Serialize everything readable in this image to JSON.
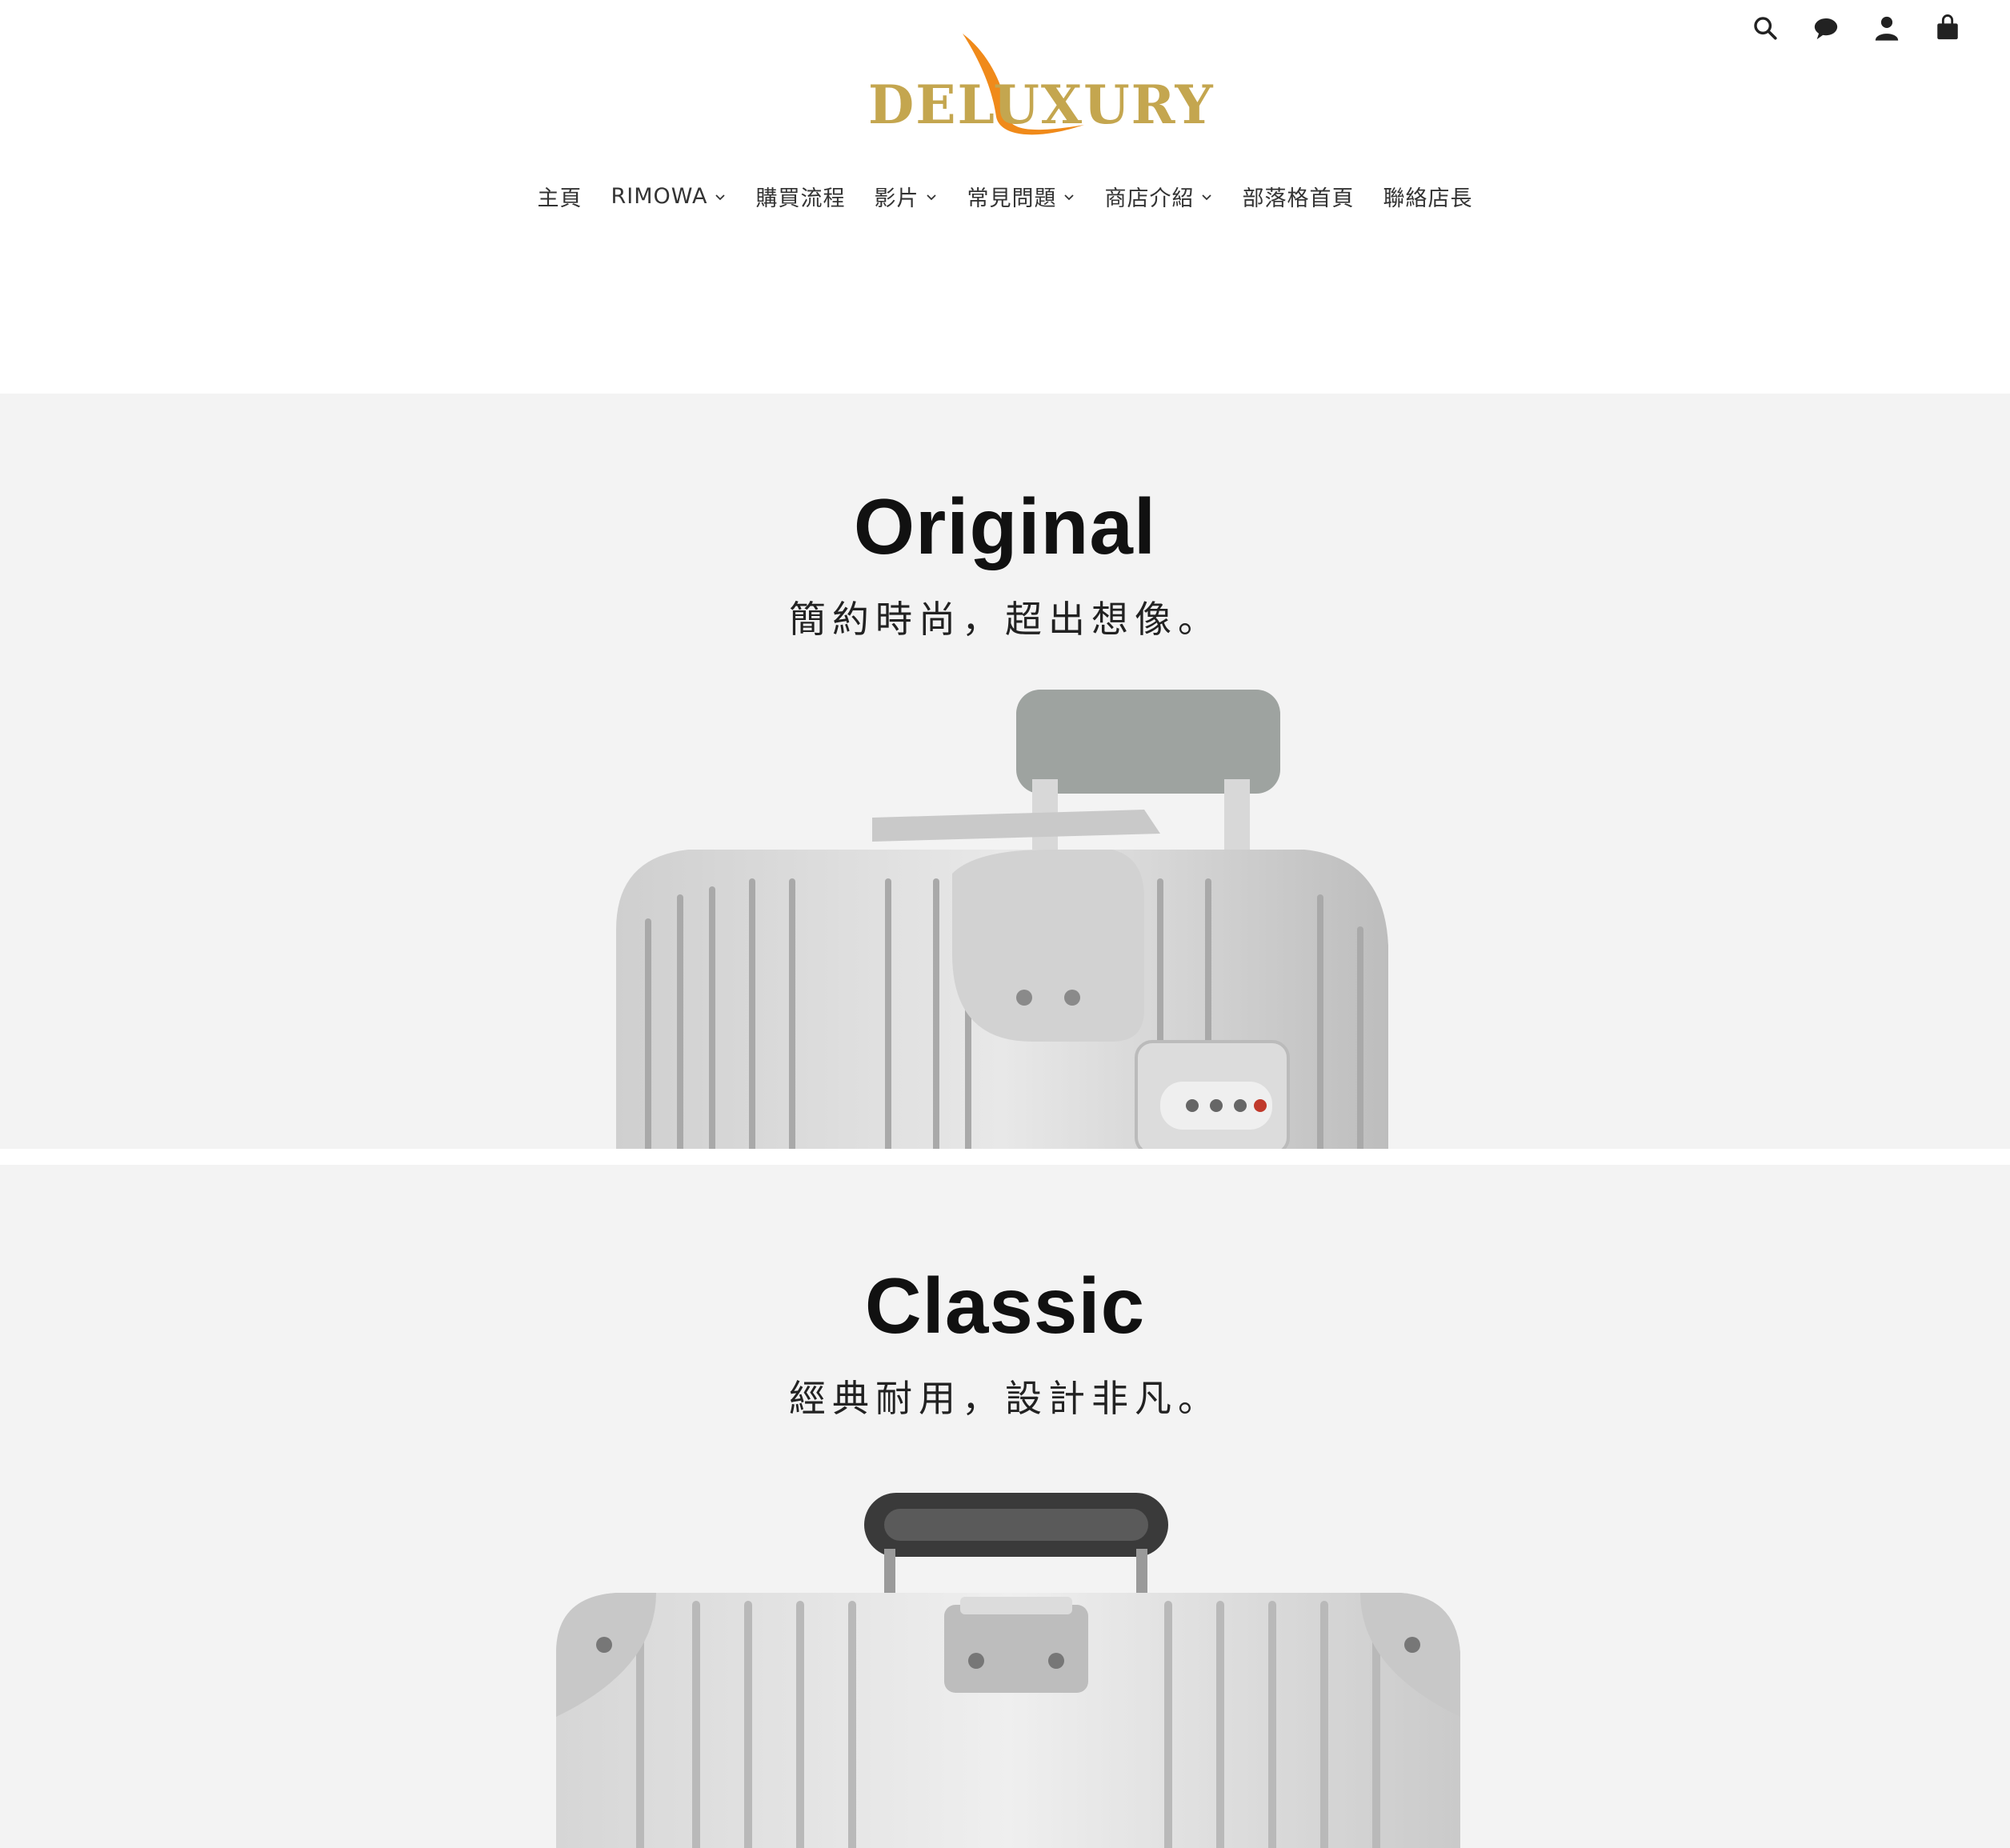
{
  "brand": {
    "logo_text": "DELUXURY",
    "gold": "#c4a64f",
    "accent_orange": "#f08a1a"
  },
  "header_icons": [
    "search-icon",
    "chat-icon",
    "account-icon",
    "cart-icon"
  ],
  "nav": {
    "items": [
      {
        "label": "主頁",
        "dropdown": false
      },
      {
        "label": "RIMOWA",
        "dropdown": true
      },
      {
        "label": "購買流程",
        "dropdown": false
      },
      {
        "label": "影片",
        "dropdown": true
      },
      {
        "label": "常見問題",
        "dropdown": true
      },
      {
        "label": "商店介紹",
        "dropdown": true
      },
      {
        "label": "部落格首頁",
        "dropdown": false
      },
      {
        "label": "聯絡店長",
        "dropdown": false
      }
    ]
  },
  "sections": [
    {
      "title": "Original",
      "subtitle": "簡約時尚，超出想像。",
      "background": "#f3f3f3"
    },
    {
      "title": "Classic",
      "subtitle": "經典耐用，設計非凡。",
      "background": "#f3f3f3"
    }
  ]
}
